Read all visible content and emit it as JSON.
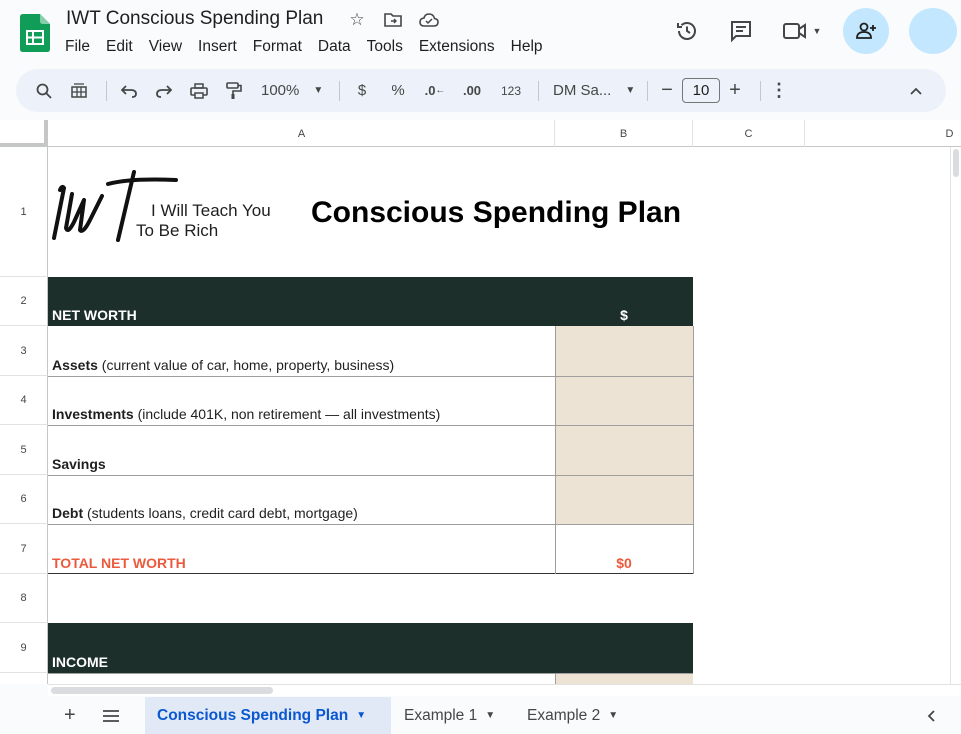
{
  "doc": {
    "title": "IWT Conscious Spending Plan"
  },
  "menu": [
    "File",
    "Edit",
    "View",
    "Insert",
    "Format",
    "Data",
    "Tools",
    "Extensions",
    "Help"
  ],
  "toolbar": {
    "zoom": "100%",
    "currency": "$",
    "percent": "%",
    "dec_decrease": ".0",
    "dec_increase": ".00",
    "number_format": "123",
    "font": "DM Sa...",
    "font_size": "10"
  },
  "columns": [
    "A",
    "B",
    "C",
    "D"
  ],
  "rows": [
    "1",
    "2",
    "3",
    "4",
    "5",
    "6",
    "7",
    "8",
    "9"
  ],
  "sheet": {
    "logo": {
      "line1": "I Will Teach You",
      "line2": "To Be Rich"
    },
    "title": "Conscious Spending Plan",
    "net_worth_header": "NET WORTH",
    "currency_header": "$",
    "assets_label": "Assets",
    "assets_note": " (current value of car, home, property, business)",
    "investments_label": "Investments",
    "investments_note": " (include 401K, non retirement — all investments)",
    "savings_label": "Savings",
    "debt_label": "Debt",
    "debt_note": " (students loans, credit card debt, mortgage)",
    "total_label": "TOTAL NET WORTH",
    "total_value": "$0",
    "income_header": "INCOME"
  },
  "tabs": [
    "Conscious Spending Plan",
    "Example 1",
    "Example 2"
  ],
  "colors": {
    "dark_header": "#1d2f2b",
    "input_cell": "#ede3d5",
    "total_red": "#ec5a3c",
    "active_tab": "#0b57d0"
  }
}
